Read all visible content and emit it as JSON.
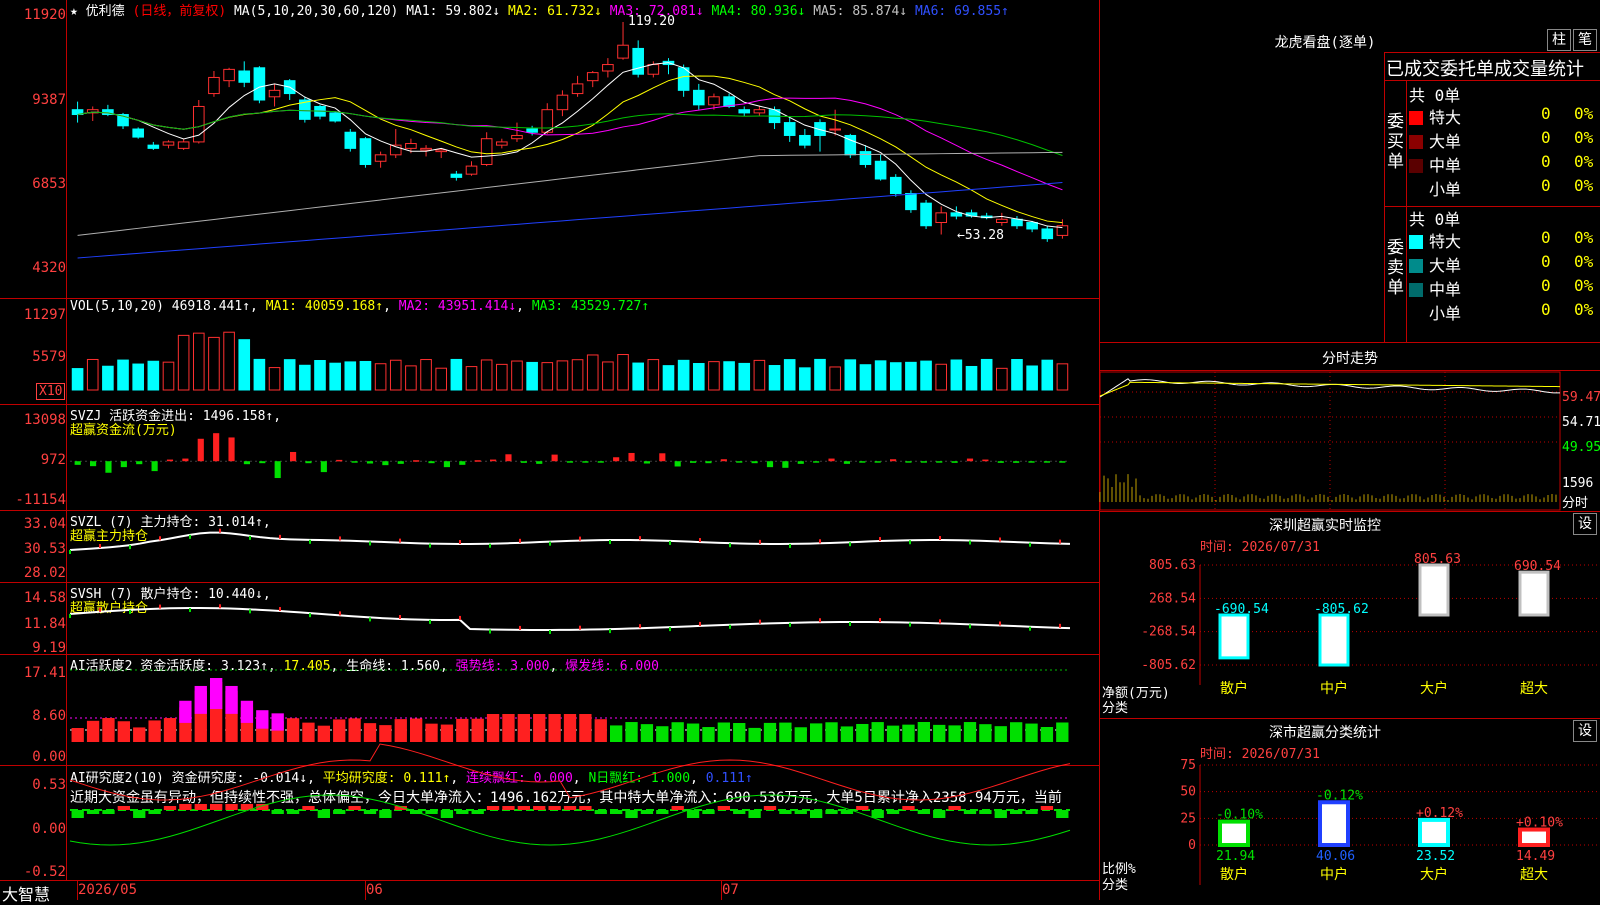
{
  "main": {
    "star": "★",
    "stock_name": "优利德",
    "period": "(日线，前复权)",
    "ma_label": "MA(5,10,20,30,60,120)",
    "ma1": "MA1: 59.802↓",
    "ma2": "MA2: 61.732↓",
    "ma3": "MA3: 72.081↓",
    "ma4": "MA4: 80.936↓",
    "ma5": "MA5: 85.874↓",
    "ma6": "MA6: 69.855↑",
    "y_ticks": [
      "11920",
      "9387",
      "6853",
      "4320"
    ],
    "high_label": "119.20",
    "low_label": "←53.28"
  },
  "vol": {
    "title": "VOL(5,10,20)",
    "value": "46918.441↑",
    "ma1": "MA1: 40059.168↑",
    "ma2": "MA2: 43951.414↓",
    "ma3": "MA3: 43529.727↑",
    "y_ticks": [
      "11297",
      "5579"
    ],
    "unit": "X10"
  },
  "svzj": {
    "title": "SVZJ  活跃资金进出: 1496.158↑,",
    "sub": "超赢资金流(万元)",
    "y_ticks": [
      "13098",
      "972",
      "-11154"
    ]
  },
  "svzl": {
    "title": "SVZL (7) 主力持仓: 31.014↑,",
    "sub": "超赢主力持仓",
    "y_ticks": [
      "33.04",
      "30.53",
      "28.02"
    ]
  },
  "svsh": {
    "title": "SVSH (7) 散户持仓: 10.440↓,",
    "sub": "超赢散户持仓",
    "y_ticks": [
      "14.58",
      "11.84",
      "9.19"
    ]
  },
  "ai_active": {
    "title": "AI活跃度2 资金活跃度: 3.123↑",
    "v2": "17.405",
    "life": "生命线: 1.560",
    "strong": "强势线: 3.000",
    "burst": "爆发线: 6.000",
    "y_ticks": [
      "17.41",
      "8.60",
      "0.00"
    ]
  },
  "ai_research": {
    "title": "AI研究度2(10) 资金研究度: -0.014↓",
    "avg": "平均研究度: 0.111↑",
    "consec": "连续飘红: 0.000",
    "nday": "N日飘红: 1.000",
    "last": "0.111↑",
    "comment": "近期大资金虽有异动，但持续性不强，总体偏空，今日大单净流入：1496.162万元，其中特大单净流入：690.536万元，大单5日累计净入2358.94万元，当前",
    "y_ticks": [
      "0.53",
      "0.00",
      "-0.52"
    ]
  },
  "xaxis": {
    "labels": [
      "2026/05",
      "06",
      "07"
    ],
    "brand": "大智慧"
  },
  "dragon": {
    "title": "龙虎看盘(逐单)",
    "btn_bar": "柱",
    "btn_pen": "笔",
    "header": "已成交委托单成交量统计",
    "buy_label": "委买单",
    "sell_label": "委卖单",
    "buy_total": "共 0单",
    "sell_total": "共 0单",
    "buy_rows": [
      {
        "name": "特大",
        "count": "0",
        "pct": "0%",
        "color": "#ff0000"
      },
      {
        "name": "大单",
        "count": "0",
        "pct": "0%",
        "color": "#8b0000"
      },
      {
        "name": "中单",
        "count": "0",
        "pct": "0%",
        "color": "#5a0000"
      },
      {
        "name": "小单",
        "count": "0",
        "pct": "0%",
        "color": "#000000"
      }
    ],
    "sell_rows": [
      {
        "name": "特大",
        "count": "0",
        "pct": "0%",
        "color": "#00ffff"
      },
      {
        "name": "大单",
        "count": "0",
        "pct": "0%",
        "color": "#008b8b"
      },
      {
        "name": "中单",
        "count": "0",
        "pct": "0%",
        "color": "#006b6b"
      },
      {
        "name": "小单",
        "count": "0",
        "pct": "0%",
        "color": "#000000"
      }
    ]
  },
  "intraday": {
    "title": "分时走势",
    "y_right": [
      "59.47",
      "54.71",
      "49.95",
      "1596",
      "分时"
    ]
  },
  "monitor": {
    "title": "深圳超赢实时监控",
    "btn": "设",
    "time": "时间: 2026/07/31",
    "y_ticks": [
      "805.63",
      "268.54",
      "-268.54",
      "-805.62"
    ],
    "ylabel": "净额(万元)",
    "xlabel": "分类",
    "categories": [
      "散户",
      "中户",
      "大户",
      "超大"
    ]
  },
  "classify": {
    "title": "深市超赢分类统计",
    "btn": "设",
    "time": "时间: 2026/07/31",
    "y_ticks": [
      "75",
      "50",
      "25",
      "0"
    ],
    "ylabel": "比例%",
    "xlabel": "分类",
    "categories": [
      "散户",
      "中户",
      "大户",
      "超大"
    ]
  },
  "chart_data": [
    {
      "type": "candlestick",
      "title": "优利德 (日线，前复权)",
      "ylim": [
        4320,
        11920
      ],
      "note": "approximate OHLC x100 read from chart",
      "ohlc": [
        [
          92.0,
          94.5,
          88.0,
          90.5
        ],
        [
          91.0,
          93.0,
          88.5,
          92.0
        ],
        [
          92.0,
          93.5,
          90.0,
          90.5
        ],
        [
          90.5,
          91.0,
          86.0,
          87.0
        ],
        [
          86.0,
          86.5,
          83.0,
          83.5
        ],
        [
          81.0,
          82.0,
          79.5,
          80.0
        ],
        [
          81.0,
          82.5,
          80.0,
          82.0
        ],
        [
          80.0,
          83.0,
          79.5,
          82.0
        ],
        [
          82.0,
          95.0,
          81.5,
          93.0
        ],
        [
          97.0,
          104.0,
          96.0,
          102.0
        ],
        [
          101.0,
          105.0,
          99.0,
          104.5
        ],
        [
          104.0,
          107.0,
          99.0,
          100.5
        ],
        [
          105.0,
          105.5,
          94.0,
          95.0
        ],
        [
          96.0,
          100.0,
          93.0,
          98.0
        ],
        [
          101.0,
          101.5,
          95.0,
          97.0
        ],
        [
          95.0,
          96.0,
          88.0,
          89.0
        ],
        [
          93.0,
          93.5,
          89.0,
          90.0
        ],
        [
          91.0,
          91.5,
          88.0,
          88.5
        ],
        [
          85.0,
          86.0,
          79.0,
          80.0
        ],
        [
          83.0,
          83.5,
          74.0,
          75.0
        ],
        [
          76.0,
          79.0,
          74.0,
          78.0
        ],
        [
          78.0,
          86.0,
          77.0,
          81.0
        ],
        [
          80.0,
          83.0,
          78.5,
          81.5
        ],
        [
          79.5,
          81.0,
          77.5,
          80.0
        ],
        [
          79.0,
          80.0,
          77.0,
          79.5
        ],
        [
          72.0,
          73.0,
          70.0,
          71.0
        ],
        [
          72.0,
          76.0,
          71.5,
          74.5
        ],
        [
          75.0,
          85.0,
          74.5,
          83.0
        ],
        [
          81.0,
          83.0,
          80.0,
          82.0
        ],
        [
          83.0,
          88.0,
          82.0,
          84.0
        ],
        [
          86.0,
          87.0,
          84.0,
          85.0
        ],
        [
          85.0,
          94.0,
          84.5,
          92.0
        ],
        [
          92.0,
          98.0,
          90.0,
          96.5
        ],
        [
          97.0,
          102.5,
          96.0,
          100.0
        ],
        [
          101.0,
          104.0,
          99.0,
          103.5
        ],
        [
          104.0,
          108.0,
          102.0,
          106.0
        ],
        [
          108.0,
          119.2,
          107.5,
          112.0
        ],
        [
          111.0,
          113.5,
          102.0,
          103.0
        ],
        [
          103.0,
          107.0,
          102.0,
          106.0
        ],
        [
          107.0,
          108.0,
          103.0,
          106.0
        ],
        [
          105.0,
          106.0,
          96.0,
          98.0
        ],
        [
          98.0,
          100.0,
          92.0,
          93.5
        ],
        [
          93.5,
          97.0,
          92.0,
          96.0
        ],
        [
          96.0,
          97.0,
          92.5,
          93.0
        ],
        [
          92.0,
          93.0,
          90.0,
          91.0
        ],
        [
          91.0,
          93.0,
          90.0,
          92.0
        ],
        [
          92.0,
          93.0,
          86.0,
          88.0
        ],
        [
          88.0,
          90.0,
          82.0,
          84.0
        ],
        [
          84.0,
          86.0,
          80.0,
          81.0
        ],
        [
          88.0,
          89.0,
          79.0,
          84.0
        ],
        [
          86.0,
          92.0,
          84.0,
          86.0
        ],
        [
          84.0,
          84.5,
          77.0,
          78.0
        ],
        [
          79.0,
          81.0,
          74.0,
          75.0
        ],
        [
          76.0,
          78.0,
          70.0,
          70.5
        ],
        [
          71.0,
          72.0,
          65.0,
          66.0
        ],
        [
          66.0,
          67.0,
          60.0,
          61.0
        ],
        [
          63.0,
          64.0,
          55.0,
          56.0
        ],
        [
          57.0,
          62.0,
          53.28,
          60.0
        ],
        [
          60.0,
          62.0,
          58.0,
          59.0
        ],
        [
          60.0,
          61.0,
          58.5,
          59.0
        ],
        [
          59.0,
          60.0,
          58.0,
          58.5
        ],
        [
          57.0,
          60.0,
          56.0,
          58.0
        ],
        [
          58.0,
          59.0,
          55.0,
          56.0
        ],
        [
          57.0,
          57.5,
          54.0,
          55.0
        ],
        [
          55.0,
          56.0,
          51.0,
          52.0
        ],
        [
          53.0,
          58.0,
          52.0,
          56.0
        ]
      ]
    },
    {
      "type": "bar",
      "title": "超赢资金流(万元)",
      "ylim": [
        -11154,
        13098
      ],
      "values": [
        -1100,
        -1500,
        -3500,
        -1800,
        -900,
        -3000,
        500,
        800,
        6800,
        8500,
        7200,
        -900,
        -600,
        -5100,
        2800,
        -600,
        -3300,
        400,
        -300,
        -700,
        -1200,
        -800,
        300,
        -600,
        -1800,
        -1100,
        300,
        500,
        2100,
        -500,
        -800,
        2000,
        -400,
        -300,
        -300,
        1200,
        2500,
        -700,
        2400,
        -1600,
        -500,
        -600,
        600,
        -300,
        -600,
        -1800,
        -2000,
        -800,
        -300,
        800,
        -800,
        -200,
        -400,
        600,
        -400,
        -300,
        -400,
        -500,
        800,
        500,
        -500,
        -500,
        -300,
        -300,
        -300,
        -300,
        -400,
        -300,
        -400,
        -300,
        -300,
        -500,
        -500,
        -400,
        -500,
        -400,
        -300,
        -300,
        -300,
        -400,
        -300,
        -300,
        -300
      ]
    },
    {
      "type": "grouped_bar",
      "title": "深圳超赢实时监控",
      "categories": [
        "散户",
        "中户",
        "大户",
        "超大"
      ],
      "values": [
        -690.54,
        -805.62,
        805.63,
        690.54
      ],
      "ylim": [
        -805.62,
        805.63
      ]
    },
    {
      "type": "bar",
      "title": "深市超赢分类统计",
      "categories": [
        "散户",
        "中户",
        "大户",
        "超大"
      ],
      "values": [
        21.94,
        40.06,
        23.52,
        14.49
      ],
      "changes": [
        "-0.10%",
        "-0.12%",
        "+0.12%",
        "+0.10%"
      ],
      "ylim": [
        0,
        75
      ]
    }
  ]
}
